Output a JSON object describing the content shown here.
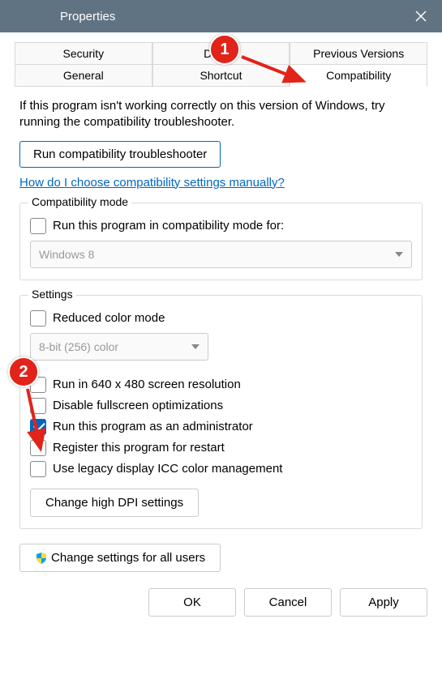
{
  "title": "Properties",
  "tabs": {
    "row1": [
      "Security",
      "Details",
      "Previous Versions"
    ],
    "row2": [
      "General",
      "Shortcut",
      "Compatibility"
    ]
  },
  "intro": "If this program isn't working correctly on this version of Windows, try running the compatibility troubleshooter.",
  "runTroubleshooter": "Run compatibility troubleshooter",
  "helpLink": "How do I choose compatibility settings manually?",
  "compatGroup": {
    "legend": "Compatibility mode",
    "checkLabel": "Run this program in compatibility mode for:",
    "selectValue": "Windows 8"
  },
  "settingsGroup": {
    "legend": "Settings",
    "reducedColor": "Reduced color mode",
    "colorSelect": "8-bit (256) color",
    "run640": "Run in 640 x 480 screen resolution",
    "disableFullscreen": "Disable fullscreen optimizations",
    "runAdmin": "Run this program as an administrator",
    "registerRestart": "Register this program for restart",
    "legacyICC": "Use legacy display ICC color management",
    "changeDPI": "Change high DPI settings"
  },
  "changeAllUsers": "Change settings for all users",
  "buttons": {
    "ok": "OK",
    "cancel": "Cancel",
    "apply": "Apply"
  },
  "annot": {
    "n1": "1",
    "n2": "2"
  }
}
